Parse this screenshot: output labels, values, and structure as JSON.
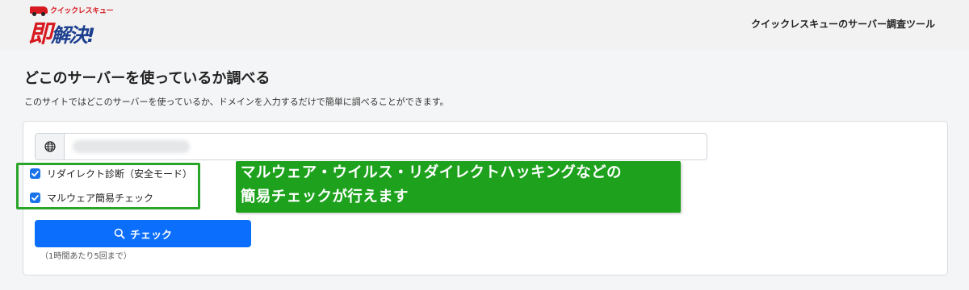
{
  "header": {
    "logo_brand": "クイックレスキュー",
    "logo_soku": "即",
    "logo_rest": "解決!",
    "title": "クイックレスキューのサーバー調査ツール"
  },
  "intro": {
    "title": "どこのサーバーを使っているか調べる",
    "description": "このサイトではどこのサーバーを使っているか、ドメインを入力するだけで簡単に調べることができます。"
  },
  "search": {
    "icon": "globe-icon",
    "value": ""
  },
  "options": [
    {
      "label": "リダイレクト診断（安全モード）",
      "checked": true
    },
    {
      "label": "マルウェア簡易チェック",
      "checked": true
    }
  ],
  "annotation": {
    "line1": "マルウェア・ウイルス・リダイレクトハッキングなどの",
    "line2": "簡易チェックが行えます"
  },
  "check_button": {
    "icon": "search-icon",
    "label": "チェック"
  },
  "limit_note": "（1時間あたり5回まで）",
  "colors": {
    "primary": "#0b6efd",
    "annotation_bg": "#1ea21e",
    "highlight_border": "#2aa52a",
    "brand_red": "#d71920",
    "brand_blue": "#1d3f8f"
  }
}
